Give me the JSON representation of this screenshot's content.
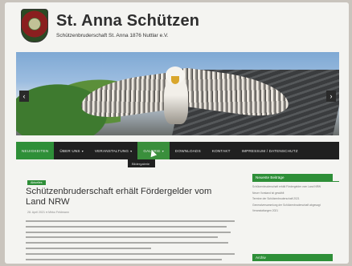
{
  "header": {
    "title": "St. Anna Schützen",
    "subtitle": "Schützenbruderschaft St. Anna 1876 Nuttlar e.V."
  },
  "slider": {
    "prev_icon": "chevron-left-icon",
    "next_icon": "chevron-right-icon",
    "prev_glyph": "‹",
    "next_glyph": "›"
  },
  "nav": {
    "items": [
      {
        "label": "NEUIGKEITEN",
        "has_caret": false
      },
      {
        "label": "ÜBER UNS",
        "has_caret": true
      },
      {
        "label": "VERANSTALTUNG",
        "has_caret": true
      },
      {
        "label": "GALERIE",
        "has_caret": true
      },
      {
        "label": "DOWNLOADS",
        "has_caret": false
      },
      {
        "label": "KONTAKT",
        "has_caret": false
      },
      {
        "label": "IMPRESSUM / DATENSCHUTZ",
        "has_caret": false
      }
    ],
    "caret_glyph": "▾",
    "dropdown_item": "Bildergalerie"
  },
  "article": {
    "category": "Aktuelles",
    "title": "Schützenbruderschaft erhält Fördergelder vom Land NRW",
    "meta": "28. April 2021   ●   Mirko Feldmann"
  },
  "sidebar": {
    "recent_heading": "Neueste Beiträge",
    "recent_items": [
      "Schützenbruderschaft erhält Fördergelder vom Land NRW",
      "Neuer Vorstand ist gewählt",
      "Termine der Schützenbruderschaft 2021",
      "Generalversammlung der Schützenbruderschaft abgesagt",
      "Veranstaltungen 2021"
    ],
    "archive_heading": "Archiv"
  },
  "colors": {
    "accent": "#2e8f38",
    "nav_bg": "#202020",
    "title_text": "#2f2f2f"
  }
}
